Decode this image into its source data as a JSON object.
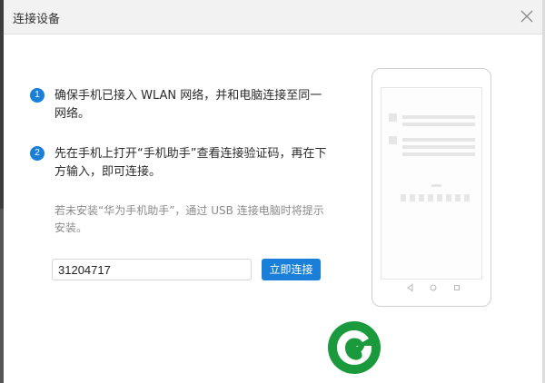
{
  "dialog": {
    "title": "连接设备"
  },
  "steps": [
    {
      "number": "1",
      "text": "确保手机已接入 WLAN 网络，并和电脑连接至同一网络。"
    },
    {
      "number": "2",
      "text": "先在手机上打开“手机助手”查看连接验证码，再在下方输入，即可连接。"
    }
  ],
  "note": "若未安装“华为手机助手”，通过 USB 连接电脑时将提示安装。",
  "code_input": {
    "value": "31204717"
  },
  "connect_button": {
    "label": "立即连接"
  },
  "colors": {
    "accent": "#1a7fd8",
    "logo_green": "#1a9a3c",
    "titlebar": "#f2f2f2"
  },
  "icons": {
    "close": "close-icon",
    "phone_back": "back-triangle-icon",
    "phone_home": "home-circle-icon",
    "phone_recent": "recent-square-icon",
    "logo": "leaf-logo"
  }
}
